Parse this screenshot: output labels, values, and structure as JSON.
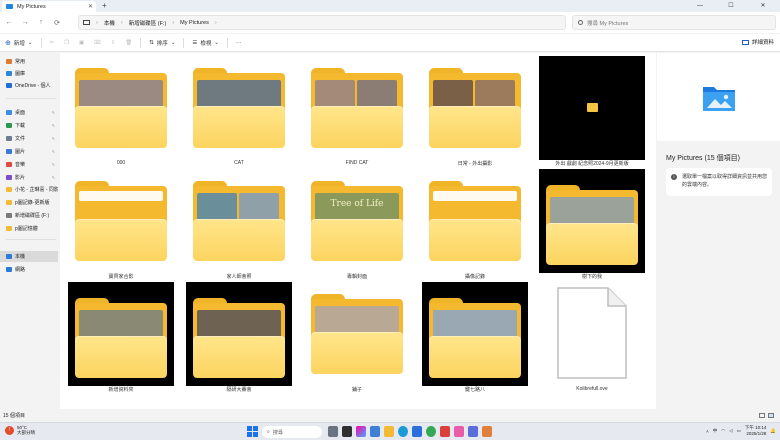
{
  "window": {
    "tab_title": "My Pictures",
    "new_tab": "+",
    "minimize": "—",
    "maximize": "☐",
    "close": "✕"
  },
  "nav": {
    "back": "←",
    "forward": "→",
    "up": "↑",
    "refresh": "⟳"
  },
  "breadcrumb": [
    "本機",
    "新增磁碟區 (F:)",
    "My Pictures"
  ],
  "search": {
    "placeholder": "搜尋 My Pictures"
  },
  "toolbar": {
    "new_label": "新增",
    "sort_label": "排序",
    "view_label": "檢視",
    "more_label": "···",
    "details_label": "詳細資料"
  },
  "sidebar": {
    "items": [
      {
        "label": "常用",
        "icon": "home-icon",
        "color": "#e07a2e"
      },
      {
        "label": "圖庫",
        "icon": "gallery-icon",
        "color": "#2b88d8"
      },
      {
        "label": "OneDrive - 個人",
        "icon": "cloud-icon",
        "color": "#1e6fd9"
      },
      {
        "label": "桌面",
        "icon": "desktop-icon",
        "color": "#3a8ee6",
        "pinned": true
      },
      {
        "label": "下載",
        "icon": "download-icon",
        "color": "#2b9a50",
        "pinned": true
      },
      {
        "label": "文件",
        "icon": "documents-icon",
        "color": "#6d7c92",
        "pinned": true
      },
      {
        "label": "圖片",
        "icon": "pictures-icon",
        "color": "#3a79d8",
        "pinned": true
      },
      {
        "label": "音樂",
        "icon": "music-icon",
        "color": "#e04a3b",
        "pinned": true
      },
      {
        "label": "影片",
        "icon": "videos-icon",
        "color": "#7b4fc9",
        "pinned": true
      },
      {
        "label": "小花 - 芷琳喜 - 同影",
        "icon": "folder-icon",
        "color": "#f3bb35"
      },
      {
        "label": "p圖記錄-更新版",
        "icon": "folder-icon",
        "color": "#f3bb35"
      },
      {
        "label": "新增磁碟區 (F:)",
        "icon": "drive-icon",
        "color": "#7a7a7a"
      },
      {
        "label": "p圖記憶體",
        "icon": "folder-icon",
        "color": "#f3bb35"
      },
      {
        "label": "本機",
        "icon": "pc-icon",
        "color": "#2b7bd8",
        "selected": true
      },
      {
        "label": "網路",
        "icon": "network-icon",
        "color": "#2b7bd8"
      }
    ]
  },
  "items": [
    {
      "name": "000",
      "kind": "folder",
      "photos": [
        "#9a8a82"
      ]
    },
    {
      "name": "CAT",
      "kind": "folder",
      "photos": [
        "#6f7a80"
      ]
    },
    {
      "name": "FIND CAT",
      "kind": "folder",
      "photos": [
        "#a48a78",
        "#8b7d74"
      ]
    },
    {
      "name": "日常 - 外出攝影",
      "kind": "folder",
      "photos": [
        "#7b6048",
        "#9b7b5c"
      ]
    },
    {
      "name": "外出 戲劇 紀念照2024-9月更新版",
      "kind": "video-black"
    },
    {
      "name": "寶貝家合影",
      "kind": "folder",
      "photos": []
    },
    {
      "name": "家人師會照",
      "kind": "folder",
      "photos": [
        "#6a8f9a",
        "#8fa0a8"
      ]
    },
    {
      "name": "專輯封面",
      "kind": "folder",
      "photos": [
        "#8b9a5a"
      ],
      "photo_text": "Tree of Life"
    },
    {
      "name": "攝像記錄",
      "kind": "folder",
      "photos": []
    },
    {
      "name": "樹下的我",
      "kind": "folder-black",
      "photos": [
        "#9aa29a"
      ]
    },
    {
      "name": "新增資料夾",
      "kind": "folder-black",
      "photos": [
        "#8a8a74"
      ]
    },
    {
      "name": "隔研大賽會",
      "kind": "folder-black",
      "photos": [
        "#6e6252"
      ]
    },
    {
      "name": "鋪子",
      "kind": "folder",
      "photos": [
        "#b8a894"
      ]
    },
    {
      "name": "鍵七路八",
      "kind": "folder-black",
      "photos": [
        "#9aa8b4"
      ]
    },
    {
      "name": "Kolibrefull.ove",
      "kind": "file"
    }
  ],
  "details_pane": {
    "title": "My Pictures (15 個項目)",
    "info_text": "選取單一檔案以取得詳細資訊並共用您的雲端內容。"
  },
  "status": {
    "count": "15 個項目"
  },
  "taskbar": {
    "temperature": "50°C",
    "weather_desc": "大部分晴",
    "search_label": "搜尋",
    "time": "下午 10:14",
    "date": "2025/1/28",
    "lang": "中"
  }
}
